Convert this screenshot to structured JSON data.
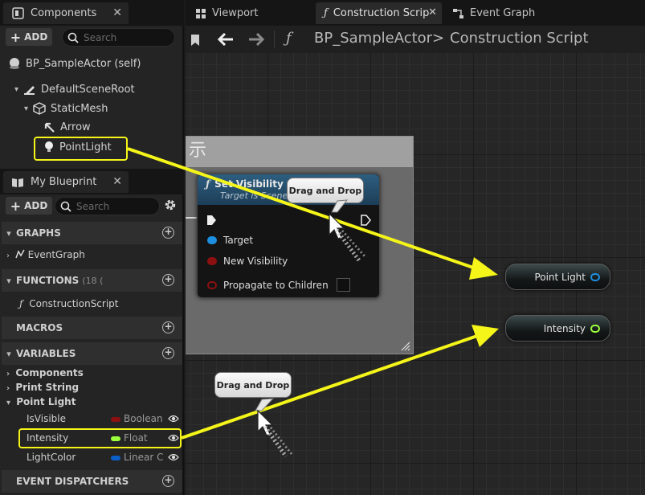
{
  "components_panel": {
    "tab_title": "Components",
    "add_label": "ADD",
    "search_placeholder": "Search",
    "root": "BP_SampleActor (self)",
    "tree": [
      {
        "label": "DefaultSceneRoot"
      },
      {
        "label": "StaticMesh"
      },
      {
        "label": "Arrow"
      },
      {
        "label": "PointLight"
      }
    ]
  },
  "my_blueprint": {
    "tab_title": "My Blueprint",
    "add_label": "ADD",
    "search_placeholder": "Search",
    "sections": {
      "graphs": "GRAPHS",
      "functions": "FUNCTIONS",
      "functions_count": "(18 (",
      "macros": "MACROS",
      "variables": "VARIABLES",
      "event_dispatchers": "EVENT DISPATCHERS"
    },
    "graph_items": [
      "EventGraph"
    ],
    "function_items": [
      "ConstructionScript"
    ],
    "variable_categories": [
      "Components",
      "Print String",
      "Point Light"
    ],
    "variables": [
      {
        "name": "IsVisible",
        "type": "Boolean",
        "color": "#8c1010"
      },
      {
        "name": "Intensity",
        "type": "Float",
        "color": "#9cff3c"
      },
      {
        "name": "LightColor",
        "type": "Linear C",
        "color": "#0b5fc8"
      }
    ]
  },
  "tabs": {
    "viewport": "Viewport",
    "construction": "Construction Scrip",
    "event_graph": "Event Graph"
  },
  "breadcrumb": {
    "blueprint": "BP_SampleActor",
    "separator": ">",
    "graph": "Construction Script"
  },
  "graph": {
    "comment_title": "示",
    "node": {
      "title": "Set Visibility",
      "subtitle": "Target is Scene",
      "pins": [
        {
          "label": "Target",
          "color": "#1d8fe0"
        },
        {
          "label": "New Visibility",
          "color": "#8c1010"
        },
        {
          "label": "Propagate to Children",
          "color": "#8c1010"
        }
      ]
    },
    "var_nodes": [
      {
        "label": "Point Light",
        "pin_color": "#1d8fe0"
      },
      {
        "label": "Intensity",
        "pin_color": "#9cff3c"
      }
    ],
    "drag_bubbles": [
      "Drag and Drop",
      "Drag and Drop"
    ]
  },
  "colors": {
    "highlight": "#f5f51a",
    "node_header": "#2d5e80"
  }
}
